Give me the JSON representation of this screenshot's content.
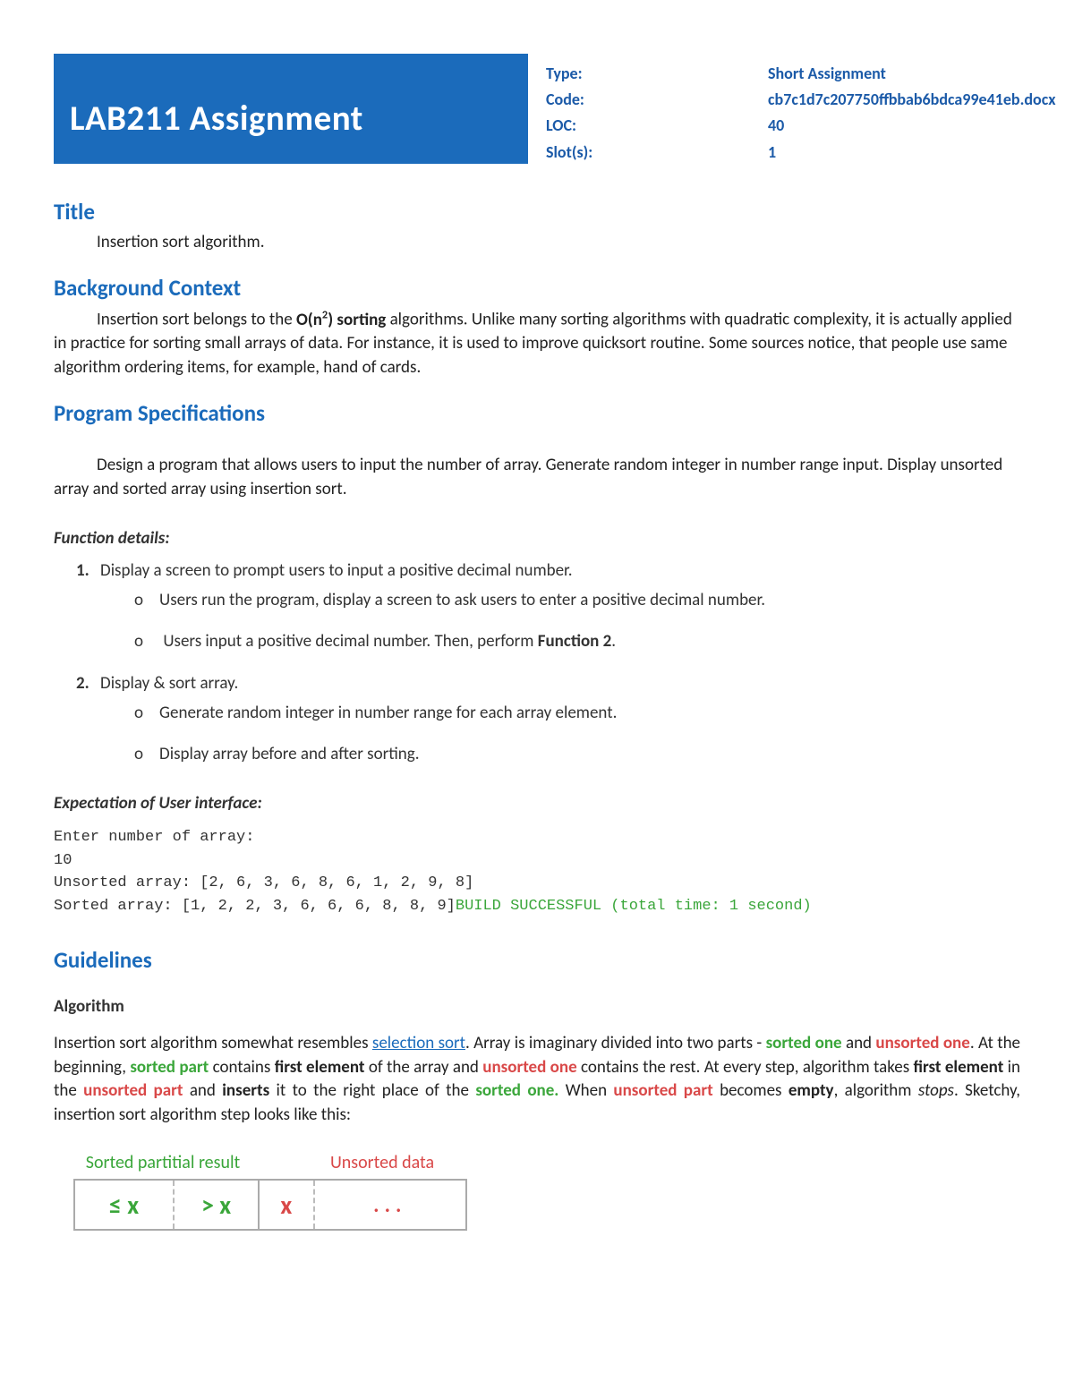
{
  "banner": "LAB211 Assignment",
  "meta": {
    "type_label": "Type:",
    "type_value": "Short Assignment",
    "code_label": "Code:",
    "code_value": "cb7c1d7c207750ffbbab6bdca99e41eb.docx",
    "loc_label": "LOC:",
    "loc_value": "40",
    "slots_label": "Slot(s):",
    "slots_value": "1"
  },
  "sections": {
    "title_h": "Title",
    "title_text": "Insertion sort algorithm.",
    "bg_h": "Background Context",
    "bg_text_pre": "Insertion sort belongs to the ",
    "bg_complexity": "O(n",
    "bg_exp": "2",
    "bg_complexity_close": ") sorting",
    "bg_text_post": " algorithms. Unlike many sorting algorithms with quadratic complexity, it is actually applied in practice for sorting small arrays of data. For instance, it is used to improve quicksort routine. Some sources notice, that people use same algorithm ordering items, for example, hand of cards.",
    "spec_h": "Program Specifications",
    "spec_text": "Design a program that allows users to input the number of array. Generate random integer in number range input. Display unsorted array and sorted array using insertion sort.",
    "func_h": "Function details:",
    "func": [
      {
        "title": "Display a screen to prompt users to input a positive decimal number.",
        "subs": [
          "Users run the program, display a screen to ask users to enter a positive decimal number.",
          {
            "pre": "Users input a positive decimal number. Then, perform ",
            "bold": "Function 2",
            "post": "."
          }
        ]
      },
      {
        "title": "Display & sort array.",
        "subs": [
          "Generate random integer in number range for each array element.",
          "Display array before and after sorting."
        ]
      }
    ],
    "expect_h": "Expectation of User interface:",
    "console": {
      "l1": "Enter number of array:",
      "l2": "10",
      "l3": "Unsorted array: [2, 6, 3, 6, 8, 6, 1, 2, 9, 8]",
      "l4a": "Sorted array: [1, 2, 2, 3, 6, 6, 6, 8, 8, 9]",
      "l4b": "BUILD SUCCESSFUL (total time: 1 second)"
    },
    "guide_h": "Guidelines",
    "algo_h": "Algorithm",
    "algo": {
      "t1": "Insertion sort algorithm somewhat resembles ",
      "link": "selection sort",
      "t2": ". Array is imaginary divided into two parts - ",
      "sorted_one": "sorted one",
      "t3": " and ",
      "unsorted_one": "unsorted one",
      "t4": ". At the beginning, ",
      "sorted_part": "sorted part",
      "t5": " contains ",
      "first_el": "first element",
      "t6": " of the array and ",
      "t7": " contains the rest. At every step, algorithm takes ",
      "t8": " in the ",
      "unsorted_part": "unsorted part",
      "t9": " and ",
      "inserts": "inserts",
      "t10": " it to the right place of the ",
      "sorted_one2": "sorted one.",
      "t11": " When ",
      "t12": " becomes ",
      "empty": "empty",
      "t13": ", algorithm ",
      "stops": "stops",
      "t14": ". Sketchy, insertion sort algorithm step looks like this:"
    },
    "diagram": {
      "label_sorted": "Sorted partitial result",
      "label_unsorted": "Unsorted data",
      "c1": "≤ x",
      "c2": "> x",
      "c3": "x",
      "c4": "..."
    }
  }
}
